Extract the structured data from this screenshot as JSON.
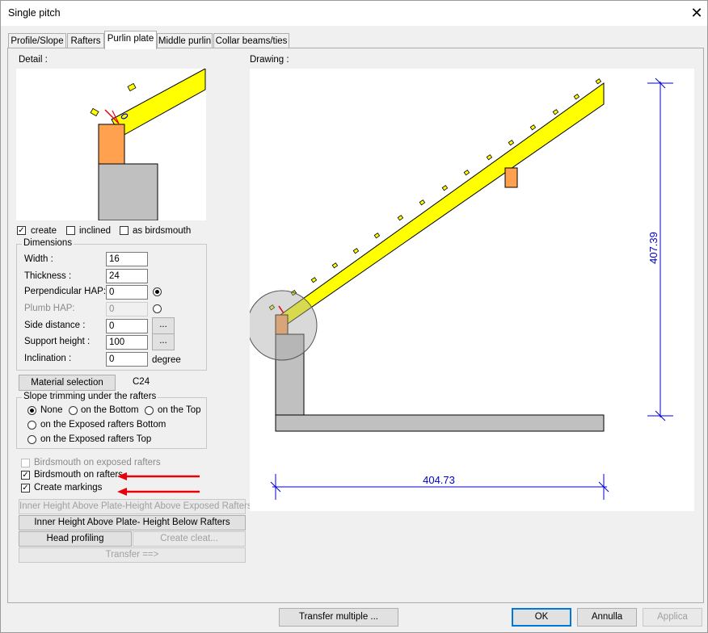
{
  "window": {
    "title": "Single pitch",
    "close_glyph": "✕"
  },
  "tabs": [
    {
      "label": "Profile/Slope",
      "active": false
    },
    {
      "label": "Rafters",
      "active": false
    },
    {
      "label": "Purlin plate",
      "active": true
    },
    {
      "label": "Middle purlin",
      "active": false
    },
    {
      "label": "Collar beams/ties",
      "active": false
    }
  ],
  "detail": {
    "label": "Detail :"
  },
  "drawing": {
    "label": "Drawing :",
    "dim_vertical": "407.39",
    "dim_horizontal": "404.73"
  },
  "options": {
    "create": {
      "label": "create",
      "checked": true
    },
    "inclined": {
      "label": "inclined",
      "checked": false
    },
    "as_birdsmouth": {
      "label": "as birdsmouth",
      "checked": false
    }
  },
  "dimensions": {
    "title": "Dimensions",
    "width": {
      "label": "Width :",
      "value": "16"
    },
    "thickness": {
      "label": "Thickness :",
      "value": "24"
    },
    "perpendicular_hap": {
      "label": "Perpendicular HAP:",
      "value": "0",
      "selected": true
    },
    "plumb_hap": {
      "label": "Plumb HAP:",
      "value": "0",
      "selected": false
    },
    "side_distance": {
      "label": "Side distance :",
      "value": "0"
    },
    "support_height": {
      "label": "Support height :",
      "value": "100"
    },
    "inclination": {
      "label": "Inclination :",
      "value": "0",
      "unit": "degree"
    },
    "browse_label": "..."
  },
  "material": {
    "button": "Material selection",
    "value": "C24"
  },
  "slope_trimming": {
    "title": "Slope trimming under the rafters",
    "none": "None",
    "bottom": "on the Bottom",
    "top": "on the Top",
    "exposed_bottom": "on the Exposed rafters Bottom",
    "exposed_top": "on the Exposed rafters Top"
  },
  "checkboxes": {
    "birdsmouth_exposed": {
      "label": "Birdsmouth on exposed rafters",
      "checked": false
    },
    "birdsmouth_rafters": {
      "label": "Birdsmouth on rafters",
      "checked": true
    },
    "create_markings": {
      "label": "Create markings",
      "checked": true
    }
  },
  "buttons": {
    "inner_height_exposed": "Inner Height Above Plate-Height Above Exposed Rafters",
    "inner_height_below": "Inner Height Above Plate- Height Below Rafters",
    "head_profiling": "Head profiling",
    "create_cleat": "Create cleat...",
    "transfer": "Transfer ==>",
    "transfer_multiple": "Transfer multiple ...",
    "ok": "OK",
    "annulla": "Annulla",
    "applica": "Applica"
  },
  "colors": {
    "rafter": "#ffff00",
    "purlin": "#ffa14f",
    "wall": "#c0c0c0",
    "dimension": "#0000cc",
    "arrow": "#e8000b"
  }
}
